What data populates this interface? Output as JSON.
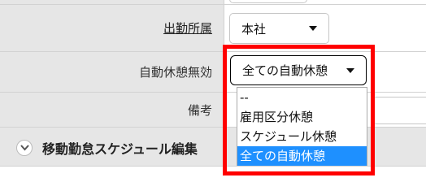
{
  "form": {
    "org": {
      "label": "出勤所属",
      "value": "本社"
    },
    "auto_break": {
      "label": "自動休憩無効",
      "value": "全ての自動休憩"
    },
    "note": {
      "label": "備考"
    }
  },
  "dropdown": {
    "options": [
      "--",
      "雇用区分休憩",
      "スケジュール休憩",
      "全ての自動休憩"
    ],
    "selected": "全ての自動休憩"
  },
  "section": {
    "title": "移動勤怠スケジュール編集"
  },
  "colors": {
    "highlight": "#ff0000",
    "selected_option": "#1e90ff",
    "label_bg": "#e6e6e6"
  }
}
